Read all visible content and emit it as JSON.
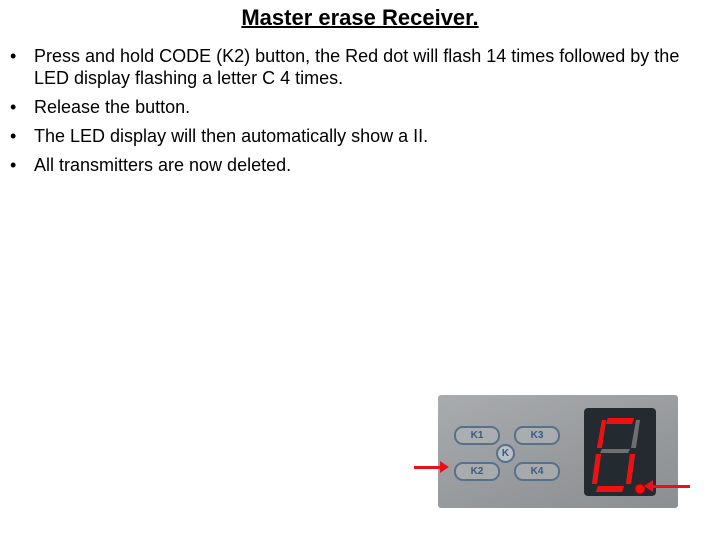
{
  "title": "Master erase Receiver.",
  "bullet_glyph": "•",
  "bullets": [
    "Press and hold CODE (K2) button, the Red dot will flash 14 times followed by the LED display flashing a letter C 4 times.",
    "Release the button.",
    "The LED display will then automatically show a II.",
    "All transmitters are now deleted."
  ],
  "photo": {
    "keys": [
      "K1",
      "K3",
      "K2",
      "K4"
    ],
    "center_label": "K",
    "led_lit_segments": [
      "a",
      "f",
      "e",
      "c",
      "d",
      "dp"
    ],
    "led_color": "#f01010",
    "arrow_color": "#e8101a",
    "arrows_point_to": [
      "K2",
      "dot"
    ]
  }
}
